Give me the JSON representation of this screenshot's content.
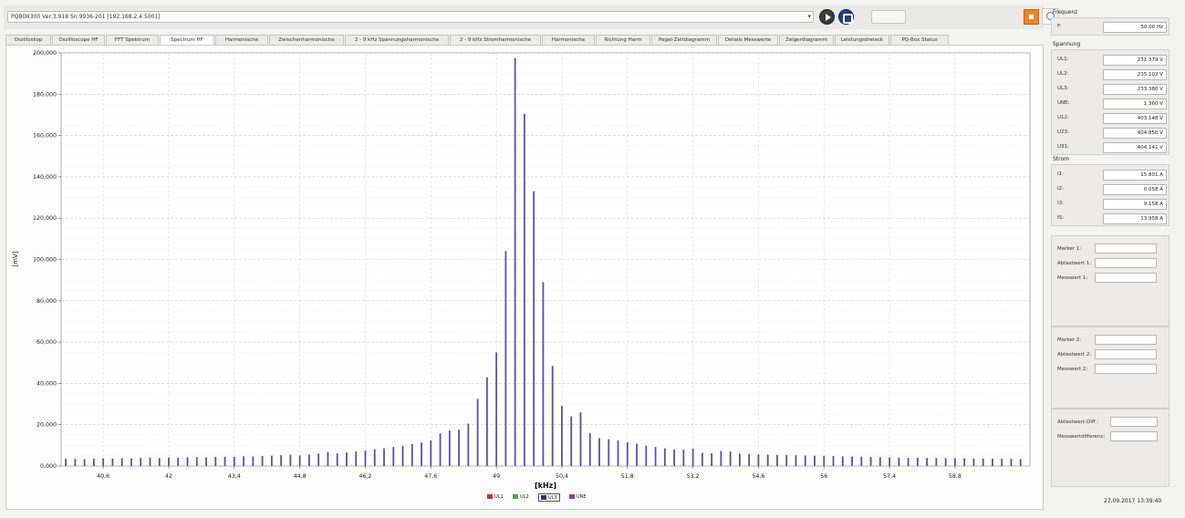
{
  "toolbar": {
    "device": "PQBOX300 Ver:3.918 Sn:9936-201 [192.168.2.4:5001]",
    "play_icon": "play-icon",
    "stop_icon": "stop-icon",
    "record_icon": "record-icon",
    "zoom_icon": "magnifier-icon"
  },
  "tabs": [
    {
      "label": "Oszilloskop"
    },
    {
      "label": "Oszilloscope HF"
    },
    {
      "label": "FFT Spektrum"
    },
    {
      "label": "Spectrum HF",
      "active": true
    },
    {
      "label": "Harmonische"
    },
    {
      "label": "Zwischenharmonische"
    },
    {
      "label": "2 - 9 kHz Spannungsharmonische"
    },
    {
      "label": "2 - 9 kHz Stromharmonische"
    },
    {
      "label": "Harmonische"
    },
    {
      "label": "Richtung Harm"
    },
    {
      "label": "Pegel-Zeitdiagramm"
    },
    {
      "label": "Details Messwerte"
    },
    {
      "label": "Zeigerdiagramm"
    },
    {
      "label": "Leistungsdreieck"
    },
    {
      "label": "PQ-Box Status"
    }
  ],
  "chart_data": {
    "type": "bar",
    "xlabel": "[kHz]",
    "ylabel": "[mV]",
    "xlim": [
      39.7,
      60.4
    ],
    "ylim": [
      0,
      200000
    ],
    "x_ticks": [
      "40,6",
      "42",
      "43,4",
      "44,8",
      "46,2",
      "47,6",
      "49",
      "50,4",
      "51,8",
      "53,2",
      "54,6",
      "56",
      "57,4",
      "58,8"
    ],
    "x_tick_values": [
      40.6,
      42,
      43.4,
      44.8,
      46.2,
      47.6,
      49,
      50.4,
      51.8,
      53.2,
      54.6,
      56,
      57.4,
      58.8
    ],
    "y_ticks": [
      "0,000",
      "20,000",
      "40,000",
      "60,000",
      "80,000",
      "100,000",
      "120,000",
      "140,000",
      "160,000",
      "180,000",
      "200,000"
    ],
    "y_tick_values": [
      0,
      20000,
      40000,
      60000,
      80000,
      100000,
      120000,
      140000,
      160000,
      180000,
      200000
    ],
    "grid": true,
    "legend_position": "bottom-center",
    "series": [
      {
        "name": "UL3",
        "color": "#5b4fa8",
        "x": [
          39.8,
          40.0,
          40.2,
          40.4,
          40.6,
          40.8,
          41.0,
          41.2,
          41.4,
          41.6,
          41.8,
          42.0,
          42.2,
          42.4,
          42.6,
          42.8,
          43.0,
          43.2,
          43.4,
          43.6,
          43.8,
          44.0,
          44.2,
          44.4,
          44.6,
          44.8,
          45.0,
          45.2,
          45.4,
          45.6,
          45.8,
          46.0,
          46.2,
          46.4,
          46.6,
          46.8,
          47.0,
          47.2,
          47.4,
          47.6,
          47.8,
          48.0,
          48.2,
          48.4,
          48.6,
          48.8,
          49.0,
          49.2,
          49.4,
          49.6,
          49.8,
          50.0,
          50.2,
          50.4,
          50.6,
          50.8,
          51.0,
          51.2,
          51.4,
          51.6,
          51.8,
          52.0,
          52.2,
          52.4,
          52.6,
          52.8,
          53.0,
          53.2,
          53.4,
          53.6,
          53.8,
          54.0,
          54.2,
          54.4,
          54.6,
          54.8,
          55.0,
          55.2,
          55.4,
          55.6,
          55.8,
          56.0,
          56.2,
          56.4,
          56.6,
          56.8,
          57.0,
          57.2,
          57.4,
          57.6,
          57.8,
          58.0,
          58.2,
          58.4,
          58.6,
          58.8,
          59.0,
          59.2,
          59.4,
          59.6,
          59.8,
          60.0,
          60.2
        ],
        "values": [
          3500,
          3400,
          3300,
          3500,
          3700,
          3600,
          3800,
          3700,
          3900,
          4000,
          3900,
          4100,
          4000,
          4200,
          4300,
          4200,
          4400,
          4500,
          4400,
          4700,
          4600,
          4900,
          5000,
          5200,
          5500,
          5100,
          5600,
          6000,
          6800,
          6200,
          6600,
          7000,
          7400,
          8200,
          8600,
          9200,
          9800,
          10600,
          11400,
          12500,
          15800,
          17200,
          17600,
          20500,
          32500,
          43000,
          55000,
          104000,
          197500,
          170500,
          133000,
          89000,
          48500,
          29000,
          24000,
          26000,
          16000,
          13500,
          13000,
          12500,
          11400,
          10800,
          9900,
          9200,
          8600,
          8000,
          7900,
          8400,
          6400,
          6200,
          7300,
          7100,
          6000,
          5800,
          5600,
          5500,
          5400,
          5300,
          5200,
          5100,
          5000,
          4900,
          4800,
          4700,
          4600,
          4500,
          4400,
          4300,
          4200,
          4100,
          4000,
          4000,
          3900,
          3900,
          3800,
          3800,
          3700,
          3700,
          3600,
          3600,
          3500,
          3500,
          3400
        ]
      }
    ],
    "legend": [
      {
        "name": "UL1",
        "color": "#e8232a"
      },
      {
        "name": "UL2",
        "color": "#3fae3a"
      },
      {
        "name": "UL3",
        "color": "#27329a"
      },
      {
        "name": "UNE",
        "color": "#8e3bb0"
      }
    ]
  },
  "right": {
    "frequenz": {
      "title": "Frequenz",
      "label": "F:",
      "value": "50.00 Hz"
    },
    "spannung": {
      "title": "Spannung",
      "rows": [
        {
          "label": "UL1:",
          "value": "231.379 V"
        },
        {
          "label": "UL2:",
          "value": "235.102 V"
        },
        {
          "label": "UL3:",
          "value": "233.380 V"
        },
        {
          "label": "UNE:",
          "value": "1.360 V"
        },
        {
          "label": "U12:",
          "value": "403.148 V"
        },
        {
          "label": "U23:",
          "value": "404.850 V"
        },
        {
          "label": "U31:",
          "value": "404.141 V"
        }
      ]
    },
    "strom": {
      "title": "Strom",
      "rows": [
        {
          "label": "I1:",
          "value": "15.801 A"
        },
        {
          "label": "I2:",
          "value": "0.058 A"
        },
        {
          "label": "I3:",
          "value": "9.158 A"
        },
        {
          "label": "IS:",
          "value": "13.958 A"
        }
      ]
    },
    "marker1": {
      "marker": "Marker 1:",
      "abtast": "Abtastwert 1:",
      "mess": "Messwert 1:"
    },
    "marker2": {
      "marker": "Marker 2:",
      "abtast": "Abtastwert 2:",
      "mess": "Messwert 2:"
    },
    "diff": {
      "abtast": "Abtastwert-Diff.:",
      "mess": "Messwertdifferenz:"
    },
    "timestamp": "27.09.2017 13:39:40"
  }
}
